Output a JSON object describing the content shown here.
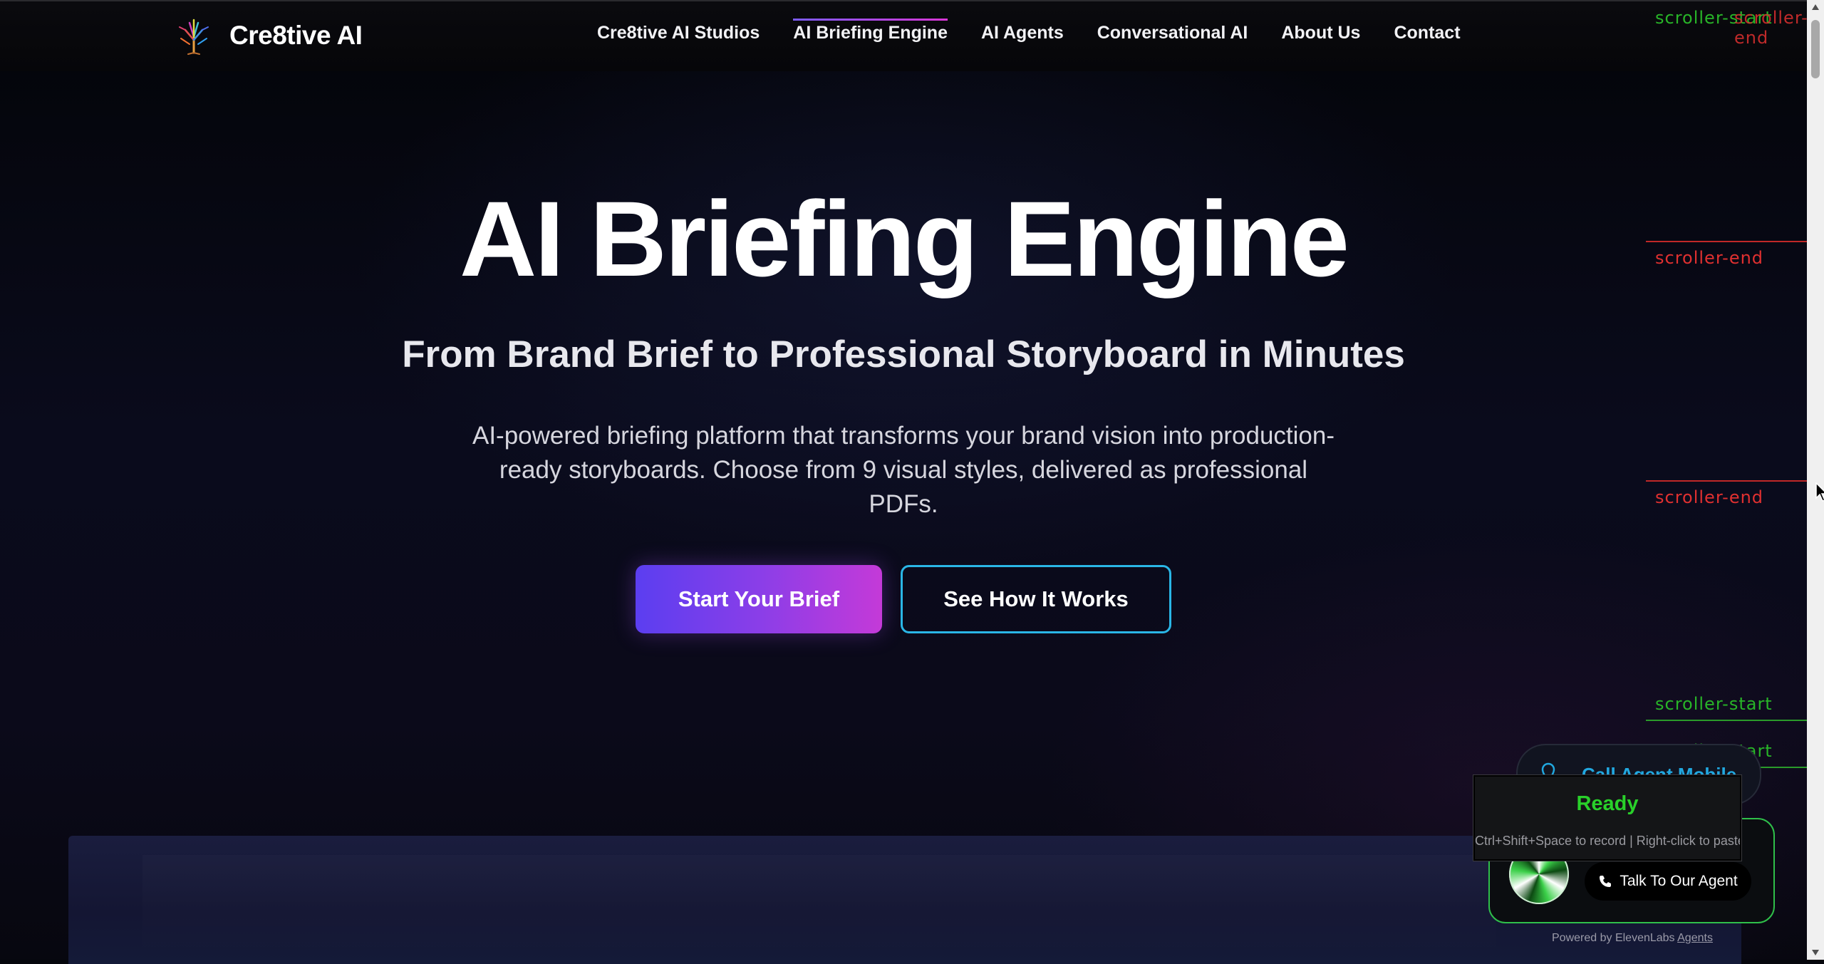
{
  "header": {
    "brand": "Cre8tive AI",
    "nav": [
      {
        "label": "Cre8tive AI Studios"
      },
      {
        "label": "AI Briefing Engine",
        "active": true
      },
      {
        "label": "AI Agents"
      },
      {
        "label": "Conversational AI"
      },
      {
        "label": "About Us"
      },
      {
        "label": "Contact"
      }
    ]
  },
  "hero": {
    "title": "AI Briefing Engine",
    "subtitle": "From Brand Brief to Professional Storyboard in Minutes",
    "description": "AI-powered briefing platform that transforms your brand vision into production-ready storyboards. Choose from 9 visual styles, delivered as professional PDFs.",
    "primary_cta": "Start Your Brief",
    "secondary_cta": "See How It Works"
  },
  "debug_markers": [
    {
      "text": "scroller-start",
      "kind": "start"
    },
    {
      "text": "scroller-end",
      "kind": "end"
    },
    {
      "text": "scroller-end",
      "kind": "end"
    },
    {
      "text": "scroller-end",
      "kind": "end"
    },
    {
      "text": "scroller-start",
      "kind": "start"
    },
    {
      "text": "scroller-start",
      "kind": "start"
    }
  ],
  "widget": {
    "mobile_label": "Call Agent Mobile",
    "recorder_status": "Ready",
    "recorder_hint": "Ctrl+Shift+Space to record | Right-click to paste",
    "talk_label": "Talk To Our Agent",
    "powered_prefix": "Powered by ElevenLabs",
    "powered_link": "Agents"
  },
  "colors": {
    "accent_gradient_start": "#5b3ef0",
    "accent_gradient_end": "#c43ad8",
    "outline_cyan": "#2ab6e6",
    "ready_green": "#29d12a",
    "marker_start": "#28b428",
    "marker_end": "#e03030"
  }
}
